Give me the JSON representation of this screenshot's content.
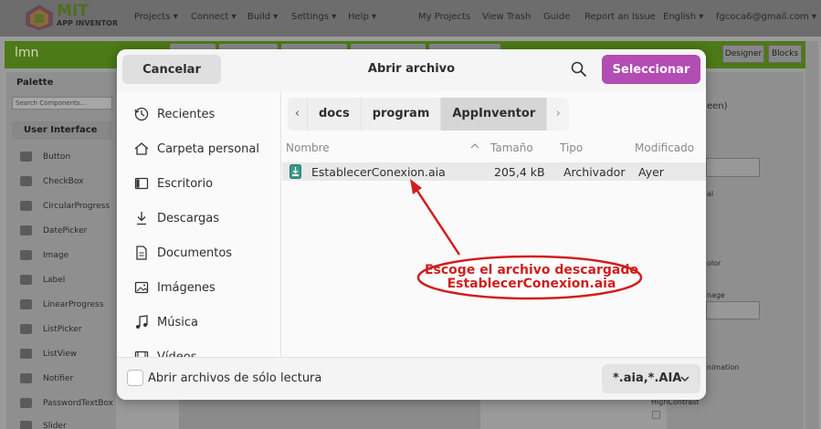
{
  "app": {
    "logo_title": "MIT",
    "logo_subtitle": "APP INVENTOR",
    "nav_left": [
      "Projects ▾",
      "Connect ▾",
      "Build ▾",
      "Settings ▾",
      "Help ▾"
    ],
    "nav_right": [
      "My Projects",
      "View Trash",
      "Guide",
      "Report an Issue",
      "English ▾",
      "fgcoca6@gmail.com ▾"
    ],
    "project_name": "lmn",
    "designer_label": "Designer",
    "blocks_label": "Blocks",
    "palette_title": "Palette",
    "search_placeholder": "Search Components...",
    "palette_section": "User Interface",
    "components": [
      "Button",
      "CheckBox",
      "CircularProgress",
      "DatePicker",
      "Image",
      "Label",
      "LinearProgress",
      "ListPicker",
      "ListView",
      "Notifier",
      "PasswordTextBox",
      "Slider"
    ],
    "props_fragments": [
      "een)",
      "al",
      "olor",
      "nage",
      "nimation",
      "HighContrast"
    ]
  },
  "dialog": {
    "title": "Abrir archivo",
    "cancel_label": "Cancelar",
    "select_label": "Seleccionar",
    "select_color": "#b34cb3",
    "search_icon": "magnifier-icon",
    "places": [
      {
        "label": "Recientes",
        "icon": "clock-icon"
      },
      {
        "label": "Carpeta personal",
        "icon": "home-icon"
      },
      {
        "label": "Escritorio",
        "icon": "desktop-icon"
      },
      {
        "label": "Descargas",
        "icon": "download-icon"
      },
      {
        "label": "Documentos",
        "icon": "document-icon"
      },
      {
        "label": "Imágenes",
        "icon": "image-icon"
      },
      {
        "label": "Música",
        "icon": "music-icon"
      },
      {
        "label": "Vídeos",
        "icon": "video-icon"
      }
    ],
    "breadcrumbs": [
      "docs",
      "program",
      "AppInventor"
    ],
    "columns": {
      "name": "Nombre",
      "size": "Tamaño",
      "type": "Tipo",
      "modified": "Modificado"
    },
    "files": [
      {
        "name": "EstablecerConexion.aia",
        "size": "205,4 kB",
        "type": "Archivador",
        "modified": "Ayer"
      }
    ],
    "readonly_label": "Abrir archivos de sólo lectura",
    "filter_label": "*.aia,*.AIA"
  },
  "annotation": {
    "line1": "Escoge el archivo descargado",
    "line2": "EstablecerConexion.aia",
    "color": "#d01e1e"
  }
}
